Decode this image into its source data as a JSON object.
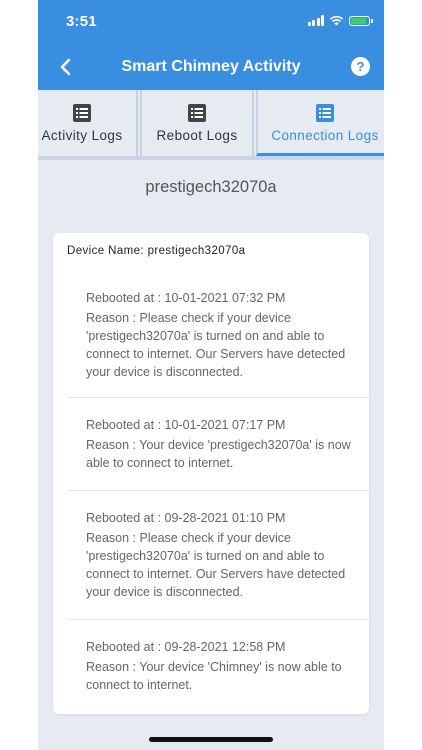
{
  "status_bar": {
    "time": "3:51"
  },
  "nav": {
    "title": "Smart Chimney Activity",
    "help_label": "?"
  },
  "tabs": [
    {
      "label": "Activity Logs"
    },
    {
      "label": "Reboot Logs"
    },
    {
      "label": "Connection Logs",
      "active": true
    }
  ],
  "device_heading": "prestigech32070a",
  "card": {
    "device_name_line": "Device Name: prestigech32070a",
    "entries": [
      {
        "when": "Rebooted at : 10-01-2021 07:32 PM",
        "reason": "Reason : Please check if your device 'prestigech32070a' is turned on and able to connect to internet. Our Servers have detected your device is disconnected."
      },
      {
        "when": "Rebooted at : 10-01-2021 07:17 PM",
        "reason": "Reason : Your device 'prestigech32070a' is now able to connect to internet."
      },
      {
        "when": "Rebooted at : 09-28-2021 01:10 PM",
        "reason": "Reason : Please check if your device 'prestigech32070a' is turned on and able to connect to internet. Our Servers have detected your device is disconnected."
      },
      {
        "when": "Rebooted at : 09-28-2021 12:58 PM",
        "reason": "Reason : Your device 'Chimney' is now able to connect to internet."
      }
    ]
  },
  "colors": {
    "accent": "#3a8ee0",
    "background": "#e6ebf2",
    "battery": "#3ad16b"
  }
}
